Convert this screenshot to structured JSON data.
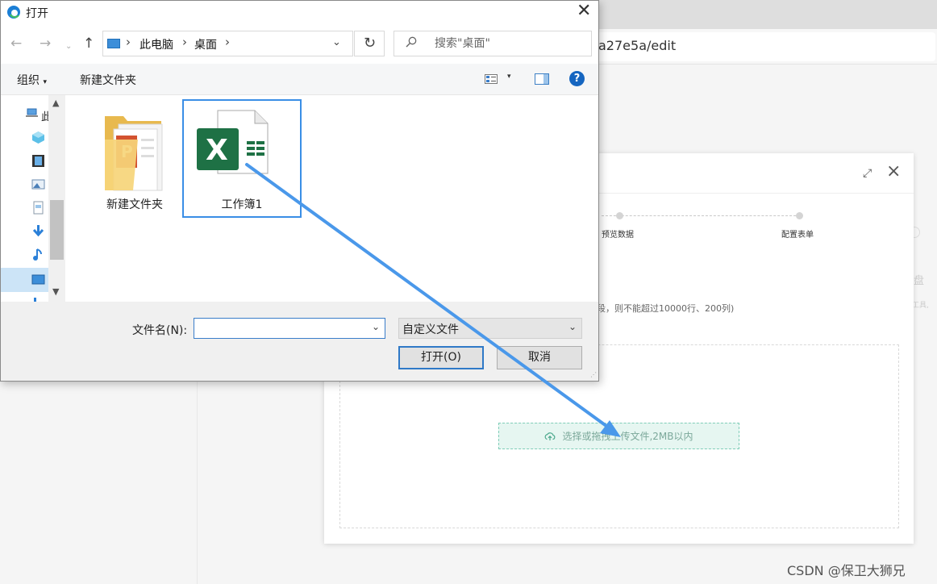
{
  "browser": {
    "url_fragment": "a27e5a/edit"
  },
  "modal": {
    "steps": [
      "预览数据",
      "配置表单"
    ],
    "hint": "段，则不能超过10000行、200列)",
    "upload_label": "选择或拖拽上传文件,2MB以内",
    "right_partial_1": "盘",
    "right_partial_2": "工具,"
  },
  "watermark": "CSDN @保卫大狮兄",
  "dialog": {
    "title": "打开",
    "breadcrumbs": [
      "此电脑",
      "桌面"
    ],
    "search_placeholder": "搜索\"桌面\"",
    "toolbar": {
      "organize": "组织",
      "new_folder": "新建文件夹"
    },
    "nav_first_label": "此",
    "files": [
      {
        "name": "新建文件夹",
        "type": "folder"
      },
      {
        "name": "工作簿1",
        "type": "excel",
        "selected": true
      }
    ],
    "filename_label": "文件名(N):",
    "filename_value": "",
    "filetype": "自定义文件",
    "open_button": "打开(O)",
    "cancel_button": "取消"
  },
  "colors": {
    "accent": "#3a8ee6",
    "excel_green": "#1e7145",
    "upload_bg": "#e6f6f1"
  }
}
